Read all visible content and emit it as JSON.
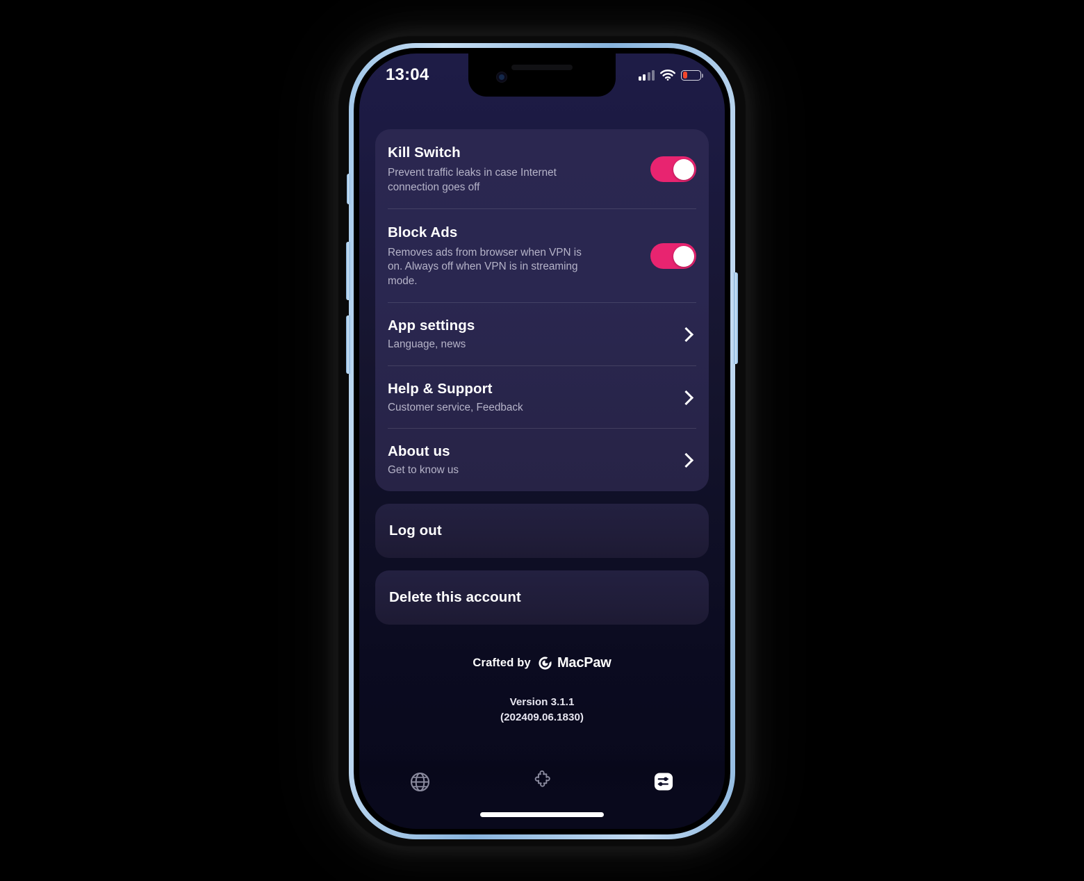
{
  "status_bar": {
    "time": "13:04",
    "signal_icon": "cellular-signal-icon",
    "signal_bars_filled": 2,
    "signal_bars_total": 4,
    "wifi_icon": "wifi-icon",
    "battery_icon": "battery-low-icon",
    "battery_percent": 26,
    "battery_color": "#f0472c"
  },
  "settings_card": {
    "rows": [
      {
        "title": "Kill Switch",
        "subtitle": "Prevent traffic leaks in case Internet connection goes off",
        "control": "toggle",
        "toggle_on": true
      },
      {
        "title": "Block Ads",
        "subtitle": "Removes ads from browser when VPN is on. Always off when VPN is in streaming mode.",
        "control": "toggle",
        "toggle_on": true
      },
      {
        "title": "App settings",
        "subtitle": "Language, news",
        "control": "chevron"
      },
      {
        "title": "Help & Support",
        "subtitle": "Customer service, Feedback",
        "control": "chevron"
      },
      {
        "title": "About us",
        "subtitle": "Get to know us",
        "control": "chevron"
      }
    ]
  },
  "actions": {
    "log_out": "Log out",
    "delete_account": "Delete this account"
  },
  "footer": {
    "crafted_by": "Crafted by",
    "brand": "MacPaw",
    "brand_icon": "macpaw-logo-icon",
    "version_line1": "Version 3.1.1",
    "version_line2": "(202409.06.1830)"
  },
  "tab_bar": {
    "tabs": [
      {
        "name": "globe-icon",
        "label": "Locations",
        "active": false
      },
      {
        "name": "puzzle-icon",
        "label": "Extensions",
        "active": false
      },
      {
        "name": "sliders-icon",
        "label": "Settings",
        "active": true
      }
    ]
  },
  "colors": {
    "accent_pink": "#e82470",
    "card_bg": "#2b2750",
    "screen_bg_top": "#1e1c47",
    "screen_bg_bottom": "#08081b",
    "action_bg": "#201d39",
    "frame": "#a9cbe9"
  }
}
